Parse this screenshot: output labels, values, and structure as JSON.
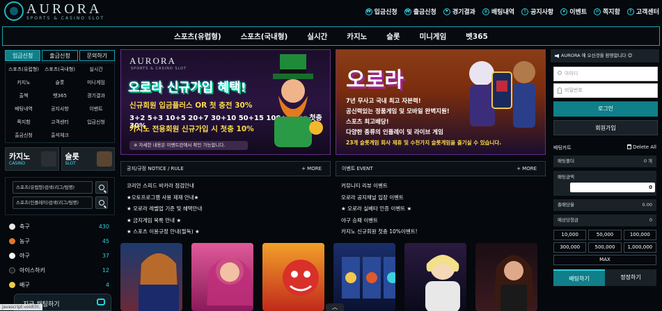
{
  "header": {
    "logo": {
      "title": "AURORA",
      "subtitle": "SPORTS & CASINO SLOT"
    },
    "top_menu": [
      {
        "label": "입금신청",
        "icon": "deposit-icon"
      },
      {
        "label": "출금신청",
        "icon": "withdraw-icon"
      },
      {
        "label": "경기결과",
        "icon": "result-icon"
      },
      {
        "label": "배팅내역",
        "icon": "history-icon"
      },
      {
        "label": "공지사항",
        "icon": "notice-icon"
      },
      {
        "label": "이벤트",
        "icon": "event-icon"
      },
      {
        "label": "쪽지함",
        "icon": "message-icon"
      },
      {
        "label": "고객센터",
        "icon": "support-icon"
      }
    ]
  },
  "main_nav": [
    "스포츠(유럽형)",
    "스포츠(국내형)",
    "실시간",
    "카지노",
    "슬롯",
    "미니게임",
    "벳365"
  ],
  "left": {
    "tabs": [
      "입금신청",
      "출금신청",
      "문의하기"
    ],
    "grid": [
      "스포츠(유럽형)",
      "스포츠(국내형)",
      "실시간",
      "카지노",
      "슬롯",
      "미니게임",
      "출첵",
      "벳365",
      "경기결과",
      "배팅내역",
      "공지사항",
      "이벤트",
      "쪽지함",
      "고객센터",
      "입금신청",
      "출금신청",
      "출석체크",
      ""
    ],
    "banners": [
      {
        "title": "카지노",
        "sub": "CASINO"
      },
      {
        "title": "슬롯",
        "sub": "SLOT"
      }
    ],
    "search": [
      {
        "placeholder": "스포츠(유럽형)검색(리그/팀명)"
      },
      {
        "placeholder": "스포츠(인플레이)검색(리그/팀명)"
      }
    ],
    "sports": [
      {
        "name": "축구",
        "count": "430",
        "color": "#e8e8e8"
      },
      {
        "name": "농구",
        "count": "45",
        "color": "#e0772a"
      },
      {
        "name": "야구",
        "count": "37",
        "color": "#f4f4f4"
      },
      {
        "name": "아이스하키",
        "count": "12",
        "color": "#1a1a1a"
      },
      {
        "name": "배구",
        "count": "4",
        "color": "#f2c94c"
      }
    ],
    "chat_label": "지금 채팅하기",
    "status_url": "javascript:void(0);"
  },
  "hero1": {
    "logo": "AURORA",
    "logo_sub": "SPORTS & CASINO SLOT",
    "headline": "오로라 신규가입 혜택!",
    "line1": "신규회원 입금플러스 OR 첫 충전 30%",
    "line2": "3+2 5+3 10+5 20+7 30+10 50+15 100+30 or 첫충 30%",
    "line3": "카지노 전용회원 신규가입 시 첫충 10%",
    "footnote": "※ 자세한 내용은 이벤트란에서 확인 가능합니다."
  },
  "hero2": {
    "headline": "오로라",
    "lines": [
      "7년 무사고 국내 최고 자본력!",
      "공신력있는 정품게임 및 모바일 완벽지원!",
      "스포츠 최고배당!",
      "다양한 종류의 인플레이 및 라이브 게임",
      "23개 슬롯게임 회사 제휴 및 수천가지 슬롯게임을 즐기실 수 있습니다."
    ]
  },
  "boards": [
    {
      "title": "공지/규정 NOTICE / RULE",
      "more": "+ MORE",
      "items": [
        "코리안 스피드 바카라 점검안내",
        "★오토프로그램 사용 제재 안내★",
        "★ 오로라 레벨업 기준 및 혜택안내",
        "★ 금지게임 목록 안내 ★",
        "★ 스포츠 이용규정 안내(필독) ★"
      ]
    },
    {
      "title": "이벤트 EVENT",
      "more": "+ MORE",
      "items": [
        "커뮤니티 리뷰 이벤트",
        "오로라 공지채널 입장 이벤트",
        "★ 오로라 실베타 인증 이벤트 ★",
        "야구 승패 이벤트",
        "카지노 신규회원 첫충 10%이벤트!"
      ]
    }
  ],
  "right": {
    "notice": "AURORA 에 오신것을 환영합니다 😊",
    "id_placeholder": "아이디",
    "pw_placeholder": "비밀번호",
    "login": "로그인",
    "join": "회원가입",
    "betslip_title": "배팅카트",
    "delete_all": "Delete All",
    "rows": [
      {
        "label": "배팅폴더",
        "value": "0 개"
      },
      {
        "label": "총배당율",
        "value": "0.00"
      },
      {
        "label": "예상당첨금",
        "value": "0"
      }
    ],
    "amount_label": "배팅금액",
    "amount_value": "0",
    "chips": [
      "10,000",
      "50,000",
      "100,000",
      "300,000",
      "500,000",
      "1,000,000"
    ],
    "max": "MAX",
    "bet": "배팅하기",
    "reset": "정정하기"
  },
  "colors": {
    "accent": "#1aa6b3",
    "accent_dark": "#0f7f89",
    "count": "#2bd0df",
    "gold": "#ffde4a"
  }
}
